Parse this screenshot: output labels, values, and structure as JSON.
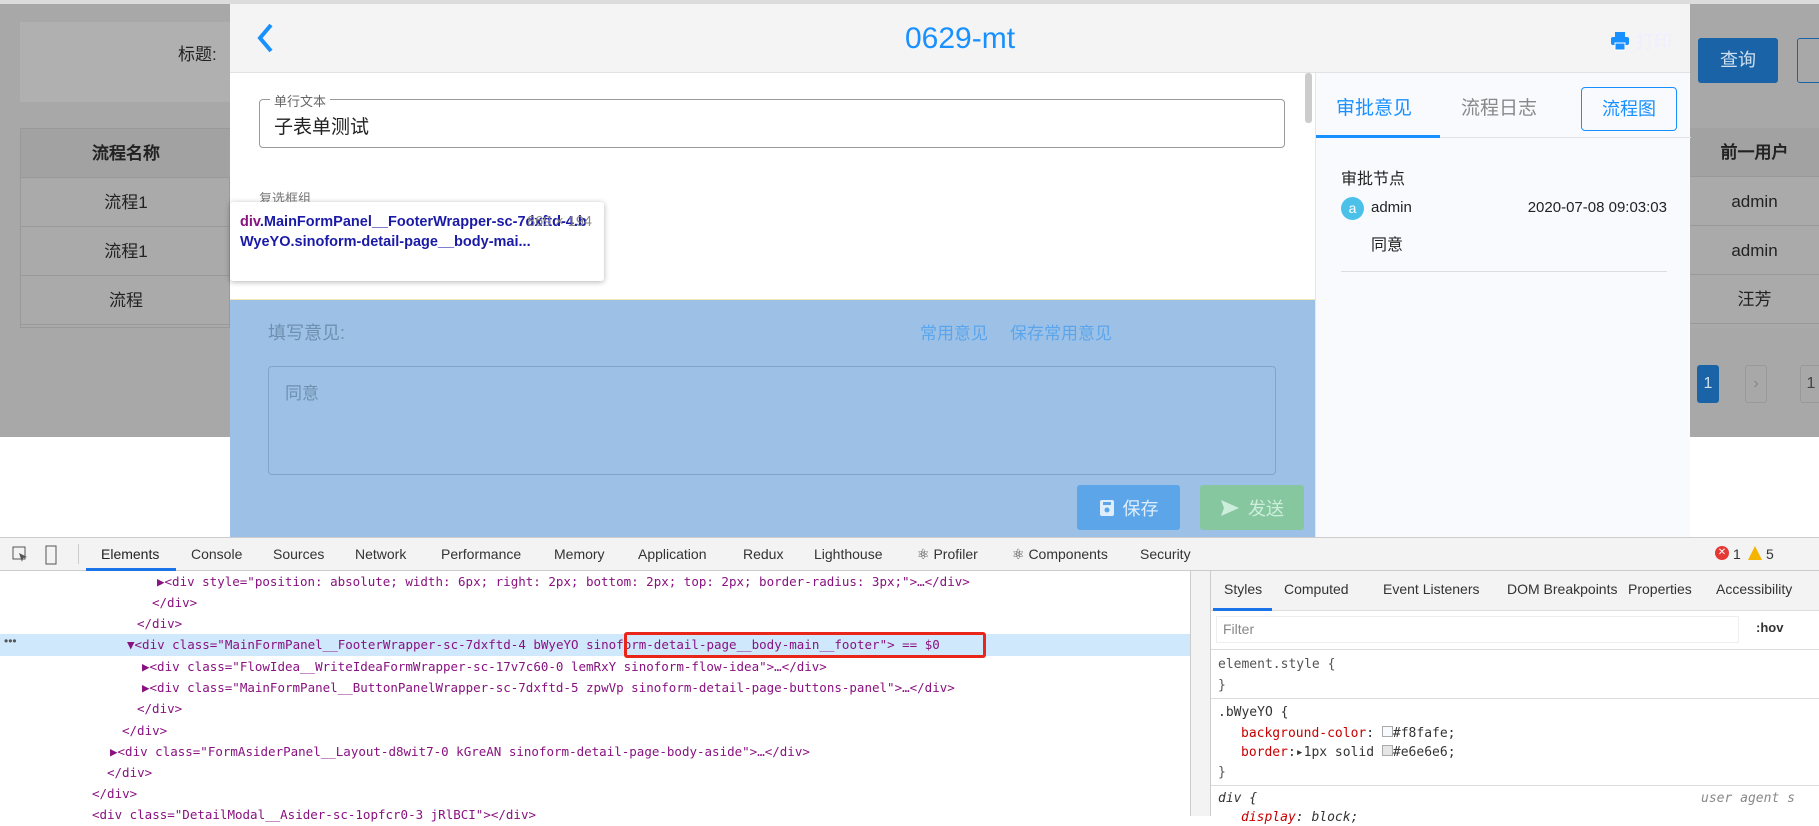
{
  "background": {
    "title_label": "标题:",
    "table_header": "流程名称",
    "rows": [
      "流程1",
      "流程1",
      "流程"
    ],
    "right_header": "前一用户",
    "right_rows": [
      "admin",
      "admin",
      "汪芳"
    ],
    "query_button": "查询",
    "page_current": "1",
    "page_next": "›",
    "page_other": "1"
  },
  "modal": {
    "title": "0629-mt",
    "print_label": "打印",
    "field": {
      "label": "单行文本",
      "value": "子表单测试"
    },
    "checkbox_group_label": "复选框组",
    "footer": {
      "idea_label": "填写意见:",
      "common_ideas": "常用意见",
      "save_common_ideas": "保存常用意见",
      "idea_value": "同意",
      "save_button": "保存",
      "send_button": "发送"
    },
    "aside": {
      "tabs": [
        "审批意见",
        "流程日志"
      ],
      "flowchart_button": "流程图",
      "node_title": "审批节点",
      "avatar_letter": "a",
      "user": "admin",
      "time": "2020-07-08 09:03:03",
      "comment": "同意"
    }
  },
  "tooltip": {
    "tag": "div",
    "selector": ".MainFormPanel__FooterWrapper-sc-7dxftd-4.bWyeYO.sinoform-detail-page__body-mai...",
    "size": "869 × 194"
  },
  "devtools": {
    "tabs": [
      "Elements",
      "Console",
      "Sources",
      "Network",
      "Performance",
      "Memory",
      "Application",
      "Redux",
      "Lighthouse",
      "⚛ Profiler",
      "⚛ Components",
      "Security"
    ],
    "errors": "1",
    "warnings": "5",
    "dom_lines": [
      "▶<div style=\"position: absolute; width: 6px; right: 2px; bottom: 2px; top: 2px; border-radius: 3px;\">…</div>",
      "</div>",
      "</div>",
      "▼<div class=\"MainFormPanel__FooterWrapper-sc-7dxftd-4 bWyeYO sinoform-detail-page__body-main__footer\"> == $0",
      "▶<div class=\"FlowIdea__WriteIdeaFormWrapper-sc-17v7c60-0 lemRxY sinoform-flow-idea\">…</div>",
      "▶<div class=\"MainFormPanel__ButtonPanelWrapper-sc-7dxftd-5 zpwVp sinoform-detail-page-buttons-panel\">…</div>",
      "</div>",
      "</div>",
      "▶<div class=\"FormAsiderPanel__Layout-d8wit7-0 kGreAN sinoform-detail-page-body-aside\">…</div>",
      "</div>",
      "</div>",
      "<div class=\"DetailModal__Asider-sc-1opfcr0-3 jRlBCI\"></div>"
    ],
    "style_tabs": [
      "Styles",
      "Computed",
      "Event Listeners",
      "DOM Breakpoints",
      "Properties",
      "Accessibility"
    ],
    "filter_placeholder": "Filter",
    "hov": ":hov",
    "rules": {
      "element_style": "element.style {",
      "close": "}",
      "selector": ".bWyeYO {",
      "bg_prop": "background-color",
      "bg_val": "#f8fafe;",
      "border_prop": "border",
      "border_val": "1px solid",
      "border_color": "#e6e6e6;",
      "div_selector": "div {",
      "display_prop": "display",
      "display_val": "block;",
      "ua": "user agent s"
    }
  },
  "colors": {
    "accent": "#1890ff",
    "highlight": "#9dc1e6",
    "overlay": "#a8a8a8"
  }
}
